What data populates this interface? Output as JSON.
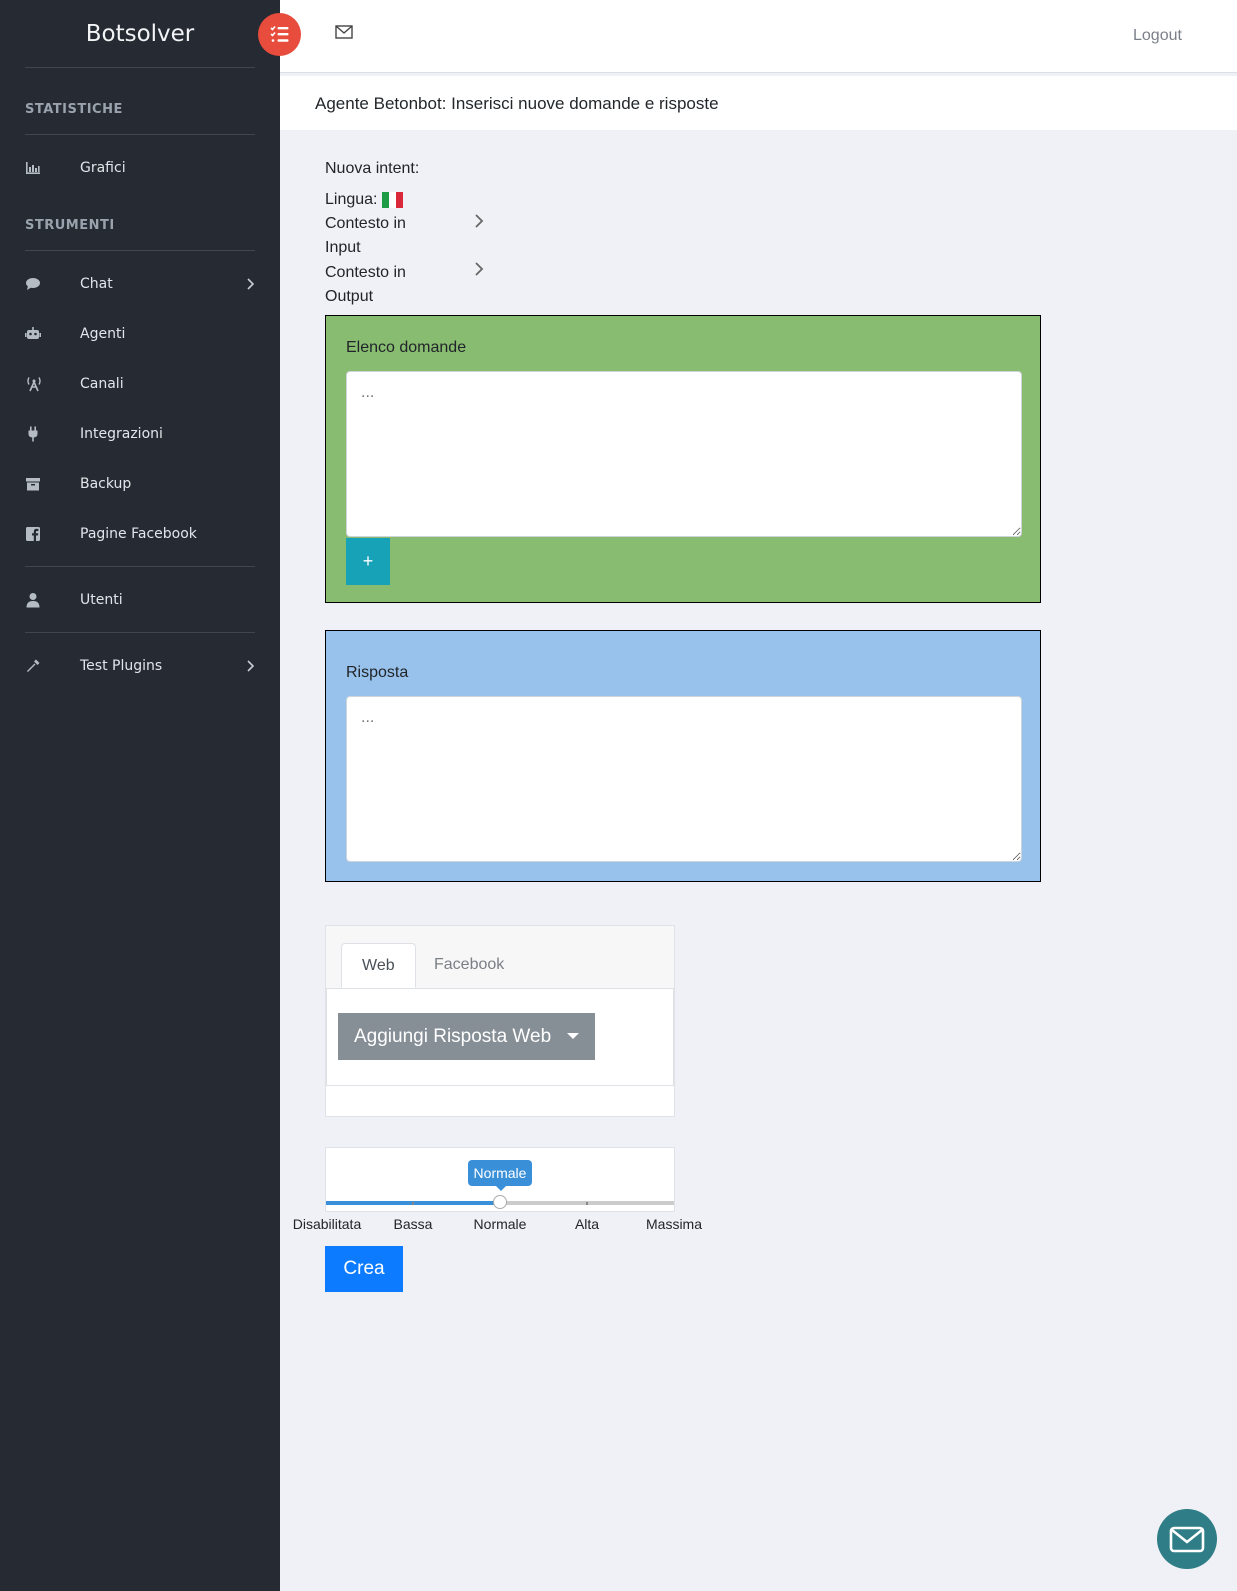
{
  "app": {
    "brand": "Botsolver"
  },
  "colors": {
    "sidebar_bg": "#262a33",
    "toggle": "#e74c3c",
    "panel_questions": "#88bc71",
    "panel_answer": "#98c2ec",
    "primary": "#0d7bff",
    "info": "#17a2b8",
    "slider": "#3a8fd9"
  },
  "sidebar": {
    "sections": [
      {
        "heading": "STATISTICHE"
      },
      {
        "heading": "STRUMENTI"
      }
    ],
    "items": [
      {
        "label": "Grafici",
        "icon": "bar-chart-icon"
      },
      {
        "label": "Chat",
        "icon": "comment-icon"
      },
      {
        "label": "Agenti",
        "icon": "robot-icon"
      },
      {
        "label": "Canali",
        "icon": "broadcast-icon"
      },
      {
        "label": "Integrazioni",
        "icon": "plug-icon"
      },
      {
        "label": "Backup",
        "icon": "archive-icon"
      },
      {
        "label": "Pagine Facebook",
        "icon": "facebook-icon"
      },
      {
        "label": "Utenti",
        "icon": "user-icon"
      },
      {
        "label": "Test Plugins",
        "icon": "eyedropper-icon"
      }
    ]
  },
  "topbar": {
    "logout": "Logout"
  },
  "page": {
    "title": "Agente Betonbot: Inserisci nuove domande e risposte"
  },
  "form": {
    "new_intent_label": "Nuova intent:",
    "language_label": "Lingua:",
    "context_in_line1": "Contesto in",
    "context_in_line2": "Input",
    "context_out_line1": "Contesto in",
    "context_out_line2": "Output",
    "questions": {
      "label": "Elenco domande",
      "placeholder": "...",
      "add_button": "+"
    },
    "answer": {
      "label": "Risposta",
      "placeholder": "..."
    },
    "tabs": [
      {
        "label": "Web",
        "active": true
      },
      {
        "label": "Facebook",
        "active": false
      }
    ],
    "add_response_button": "Aggiungi Risposta Web",
    "priority_slider": {
      "value": "Normale",
      "value_index": 2,
      "levels": [
        "Disabilitata",
        "Bassa",
        "Normale",
        "Alta",
        "Massima"
      ]
    },
    "submit_button": "Crea"
  }
}
